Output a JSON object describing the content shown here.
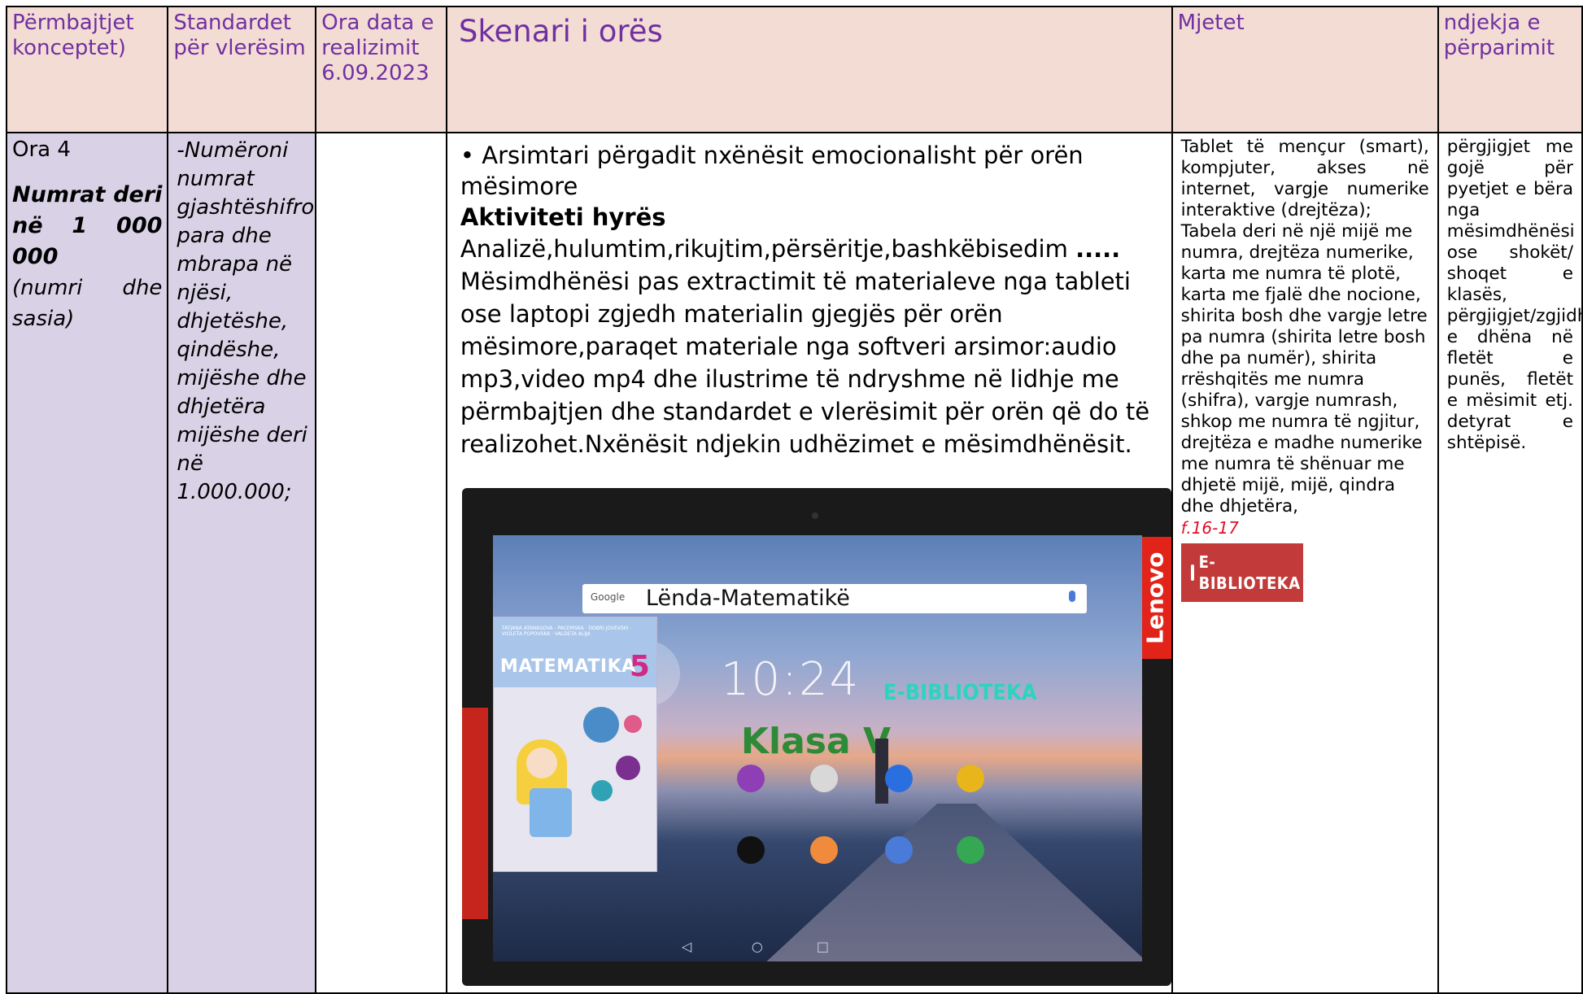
{
  "header": {
    "col1": "Përmbajtjet konceptet)",
    "col2": "Standardet për vlerësim",
    "col3": "Ora data e realizimit 6.09.2023",
    "col4": "Skenari i orës",
    "col5": "Mjetet",
    "col6": "ndjekja e përparimit"
  },
  "col1": {
    "ora": "Ora 4",
    "topic": "Numrat deri në 1 000 000",
    "subtitle": "(numri dhe sasia)"
  },
  "col2": {
    "standard": "-Numëroni numrat gjashtëshifrorë para dhe mbrapa në njësi, dhjetëshe, qindëshe, mijëshe dhe dhjetëra mijëshe deri në 1.000.000;"
  },
  "col4": {
    "intro": "• Arsimtari përgadit nxënësit emocionalisht për orën mësimore",
    "activity_title": "Aktiviteti hyrës",
    "methods": "Analizë,hulumtim,rikujtim,përsëritje,bashkëbisedim",
    "methods_dots": ".....",
    "paragraph": "Mësimdhënësi pas extractimit të materialeve nga tableti ose laptopi zgjedh materialin gjegjës për orën mësimore,paraqet materiale nga softveri arsimor:audio mp3,video mp4 dhe ilustrime të ndryshme në lidhje me përmbajtjen dhe standardet e vlerësimit për orën që do të realizohet.Nxënësit ndjekin udhëzimet e mësimdhënësit.",
    "tablet": {
      "brand": "Lenovo",
      "search_brand": "Google",
      "search_text": "Lënda-Matematikë",
      "clock": "10:24",
      "ebiblioteka": "E-BIBLIOTEKA",
      "klasa": "Klasa V",
      "book_title": "MATEMATIKA",
      "book_grade": "5",
      "book_authors": "TATJANA ATANASOVA - PACEMSKA · DOBRI JOVEVSKI · VIOLETA POPOVSKA · VALDETA ALIJA"
    }
  },
  "col5": {
    "text1": "Tablet të mençur (smart), kompjuter, akses në internet, vargje numerike interaktive (drejtëza);",
    "text2": "Tabela deri në një mijë me numra, drejtëza numerike, karta me numra të plotë, karta me fjalë dhe nocione, shirita bosh dhe vargje letre pa numra (shirita letre bosh dhe pa numër), shirita rrëshqitës me numra (shifra), vargje numrash, shkop me numra të ngjitur, drejtëza e madhe numerike me numra të shënuar me dhjetë mijë, mijë, qindra dhe dhjetëra,",
    "page_ref": "f.16-17",
    "badge": "E-BIBLIOTEKA"
  },
  "col6": {
    "text": "përgjigjet me gojë për pyetjet e bëra nga mësimdhënësi ose shokët/ shoqet e klasës, përgjigjet/zgjidhjet e dhëna në fletët e punës, fletët e mësimit etj. detyrat e shtëpisë."
  }
}
